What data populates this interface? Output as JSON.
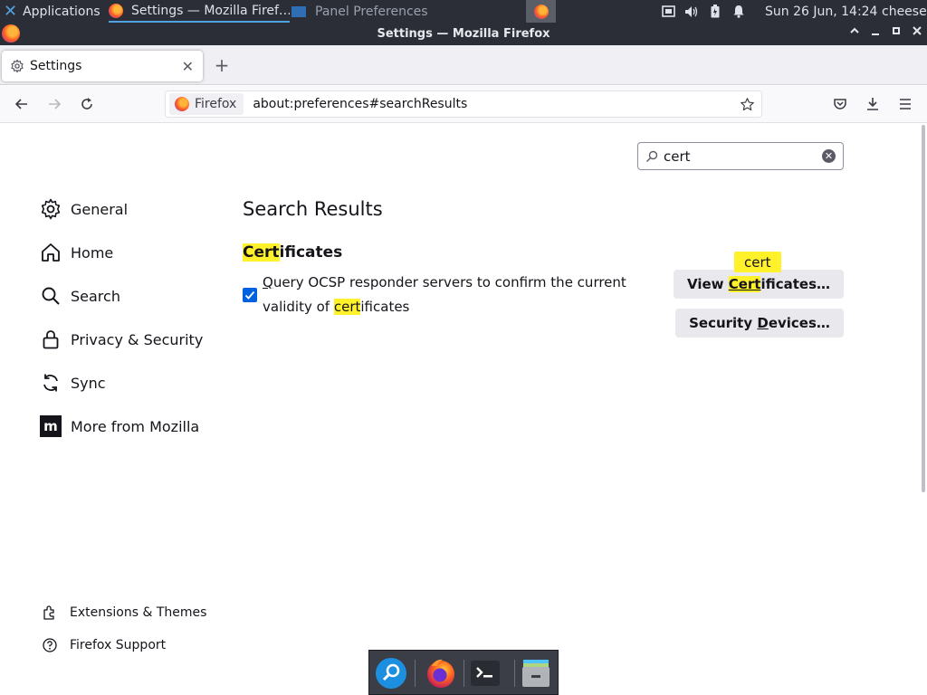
{
  "taskbar": {
    "applications_label": "Applications",
    "task1_label": "Settings — Mozilla Firef…",
    "task2_label": "Panel Preferences",
    "clock": "Sun 26 Jun, 14:24",
    "user": "cheese"
  },
  "window": {
    "title": "Settings — Mozilla Firefox"
  },
  "tab": {
    "label": "Settings"
  },
  "nav": {
    "identity_label": "Firefox",
    "url": "about:preferences#searchResults"
  },
  "search": {
    "value": "cert"
  },
  "sidebar": {
    "items": [
      {
        "label": "General",
        "icon": "gear-icon"
      },
      {
        "label": "Home",
        "icon": "home-icon"
      },
      {
        "label": "Search",
        "icon": "search-icon"
      },
      {
        "label": "Privacy & Security",
        "icon": "lock-icon"
      },
      {
        "label": "Sync",
        "icon": "sync-icon"
      },
      {
        "label": "More from Mozilla",
        "icon": "mozilla-m-icon"
      }
    ],
    "footer": [
      {
        "label": "Extensions & Themes",
        "icon": "puzzle-icon"
      },
      {
        "label": "Firefox Support",
        "icon": "help-icon"
      }
    ]
  },
  "main": {
    "results_title": "Search Results",
    "section_heading_hl": "Cert",
    "section_heading_rest": "ificates",
    "checkbox_checked": true,
    "checkbox_label_first": "Q",
    "checkbox_label_part1": "uery OCSP responder servers to confirm the current validity of ",
    "checkbox_label_hl": "cert",
    "checkbox_label_part2": "ificates",
    "view_cert_pre": "View ",
    "view_cert_hl": "Cert",
    "view_cert_post": "ificates…",
    "sec_dev_pre": "Security ",
    "sec_dev_ul": "D",
    "sec_dev_post": "evices…",
    "tooltip": "cert"
  },
  "colors": {
    "accent": "#0061e0",
    "highlight": "#fff12a",
    "panel_bg": "#2b2e37"
  },
  "dock": {
    "icons": [
      "search-app-icon",
      "firefox-icon",
      "terminal-icon",
      "file-manager-icon"
    ]
  }
}
